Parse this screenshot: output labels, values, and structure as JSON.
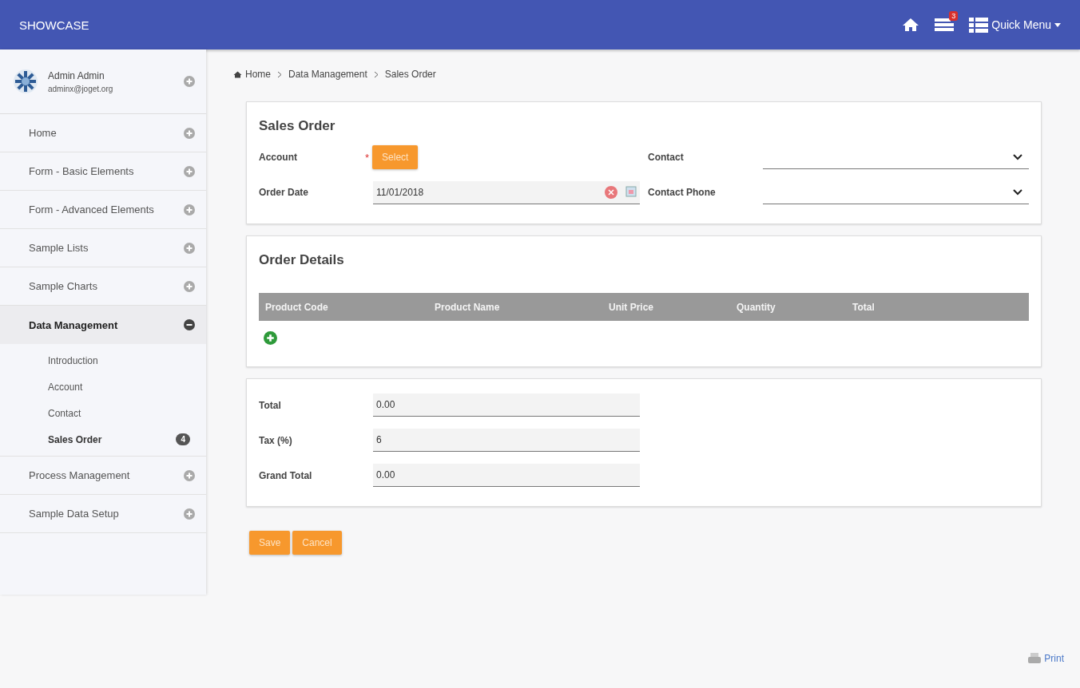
{
  "header": {
    "title": "SHOWCASE",
    "notification_count": "3",
    "quick_menu": "Quick Menu"
  },
  "user": {
    "name": "Admin Admin",
    "email": "adminx@joget.org"
  },
  "sidebar": {
    "items": [
      {
        "label": "Home",
        "expanded": false,
        "selected": false
      },
      {
        "label": "Form - Basic Elements",
        "expanded": false,
        "selected": false
      },
      {
        "label": "Form - Advanced Elements",
        "expanded": false,
        "selected": false
      },
      {
        "label": "Sample Lists",
        "expanded": false,
        "selected": false
      },
      {
        "label": "Sample Charts",
        "expanded": false,
        "selected": false
      },
      {
        "label": "Data Management",
        "expanded": true,
        "selected": true,
        "children": [
          {
            "label": "Introduction",
            "selected": false
          },
          {
            "label": "Account",
            "selected": false
          },
          {
            "label": "Contact",
            "selected": false
          },
          {
            "label": "Sales Order",
            "selected": true,
            "badge": "4"
          }
        ]
      },
      {
        "label": "Process Management",
        "expanded": false,
        "selected": false
      },
      {
        "label": "Sample Data Setup",
        "expanded": false,
        "selected": false
      }
    ]
  },
  "breadcrumb": [
    "Home",
    "Data Management",
    "Sales Order"
  ],
  "sales_order": {
    "title": "Sales Order",
    "account_label": "Account",
    "required_mark": "*",
    "account_button": "Select",
    "order_date_label": "Order Date",
    "order_date": "11/01/2018",
    "contact_label": "Contact",
    "contact_phone_label": "Contact Phone"
  },
  "order_details": {
    "title": "Order Details",
    "columns": [
      "Product Code",
      "Product Name",
      "Unit Price",
      "Quantity",
      "Total"
    ]
  },
  "totals": [
    {
      "label": "Total",
      "value": "0.00"
    },
    {
      "label": "Tax (%)",
      "value": "6"
    },
    {
      "label": "Grand Total",
      "value": "0.00"
    }
  ],
  "buttons": [
    "Save",
    "Cancel"
  ],
  "print": "Print"
}
